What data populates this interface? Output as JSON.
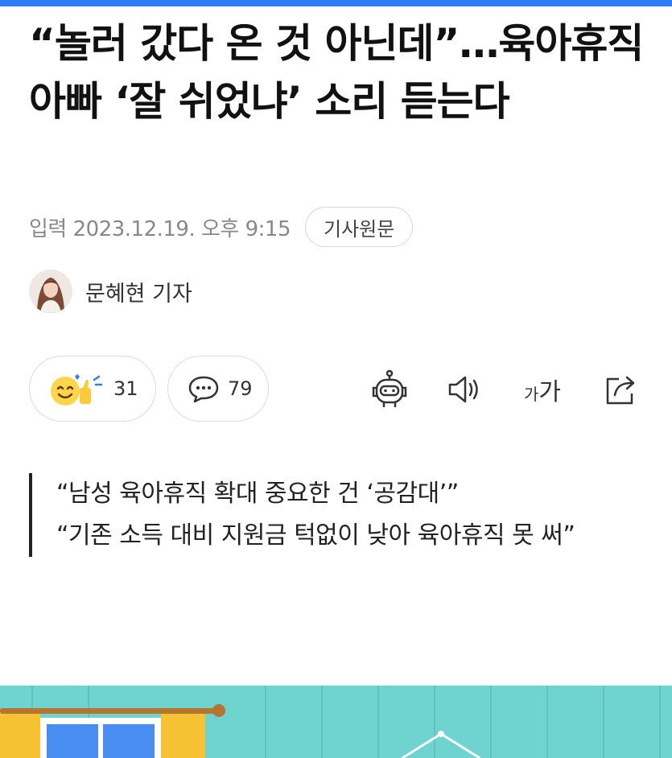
{
  "article": {
    "title": "“놀러 갔다 온 것 아닌데”…육아휴직 아빠 ‘잘 쉬었냐’ 소리 듣는다",
    "published_label": "입력 2023.12.19. 오후 9:15",
    "original_button": "기사원문",
    "author": "문혜현 기자"
  },
  "actions": {
    "reaction_count": "31",
    "comment_count": "79",
    "font_small": "가",
    "font_big": "가"
  },
  "summary": {
    "lines": [
      "“남성 육아휴직 확대 중요한 건 ‘공감대’”",
      "“기존 소득 대비 지원금 턱없이 낮아 육아휴직 못 써”"
    ]
  },
  "colors": {
    "accent": "#2f7df6",
    "quote_bar": "#222222",
    "hero_bg": "#6fd3cf"
  },
  "icons": [
    "emoji-thumbs-up-icon",
    "comment-icon",
    "robot-summary-icon",
    "speaker-icon",
    "font-size-icon",
    "share-icon"
  ]
}
